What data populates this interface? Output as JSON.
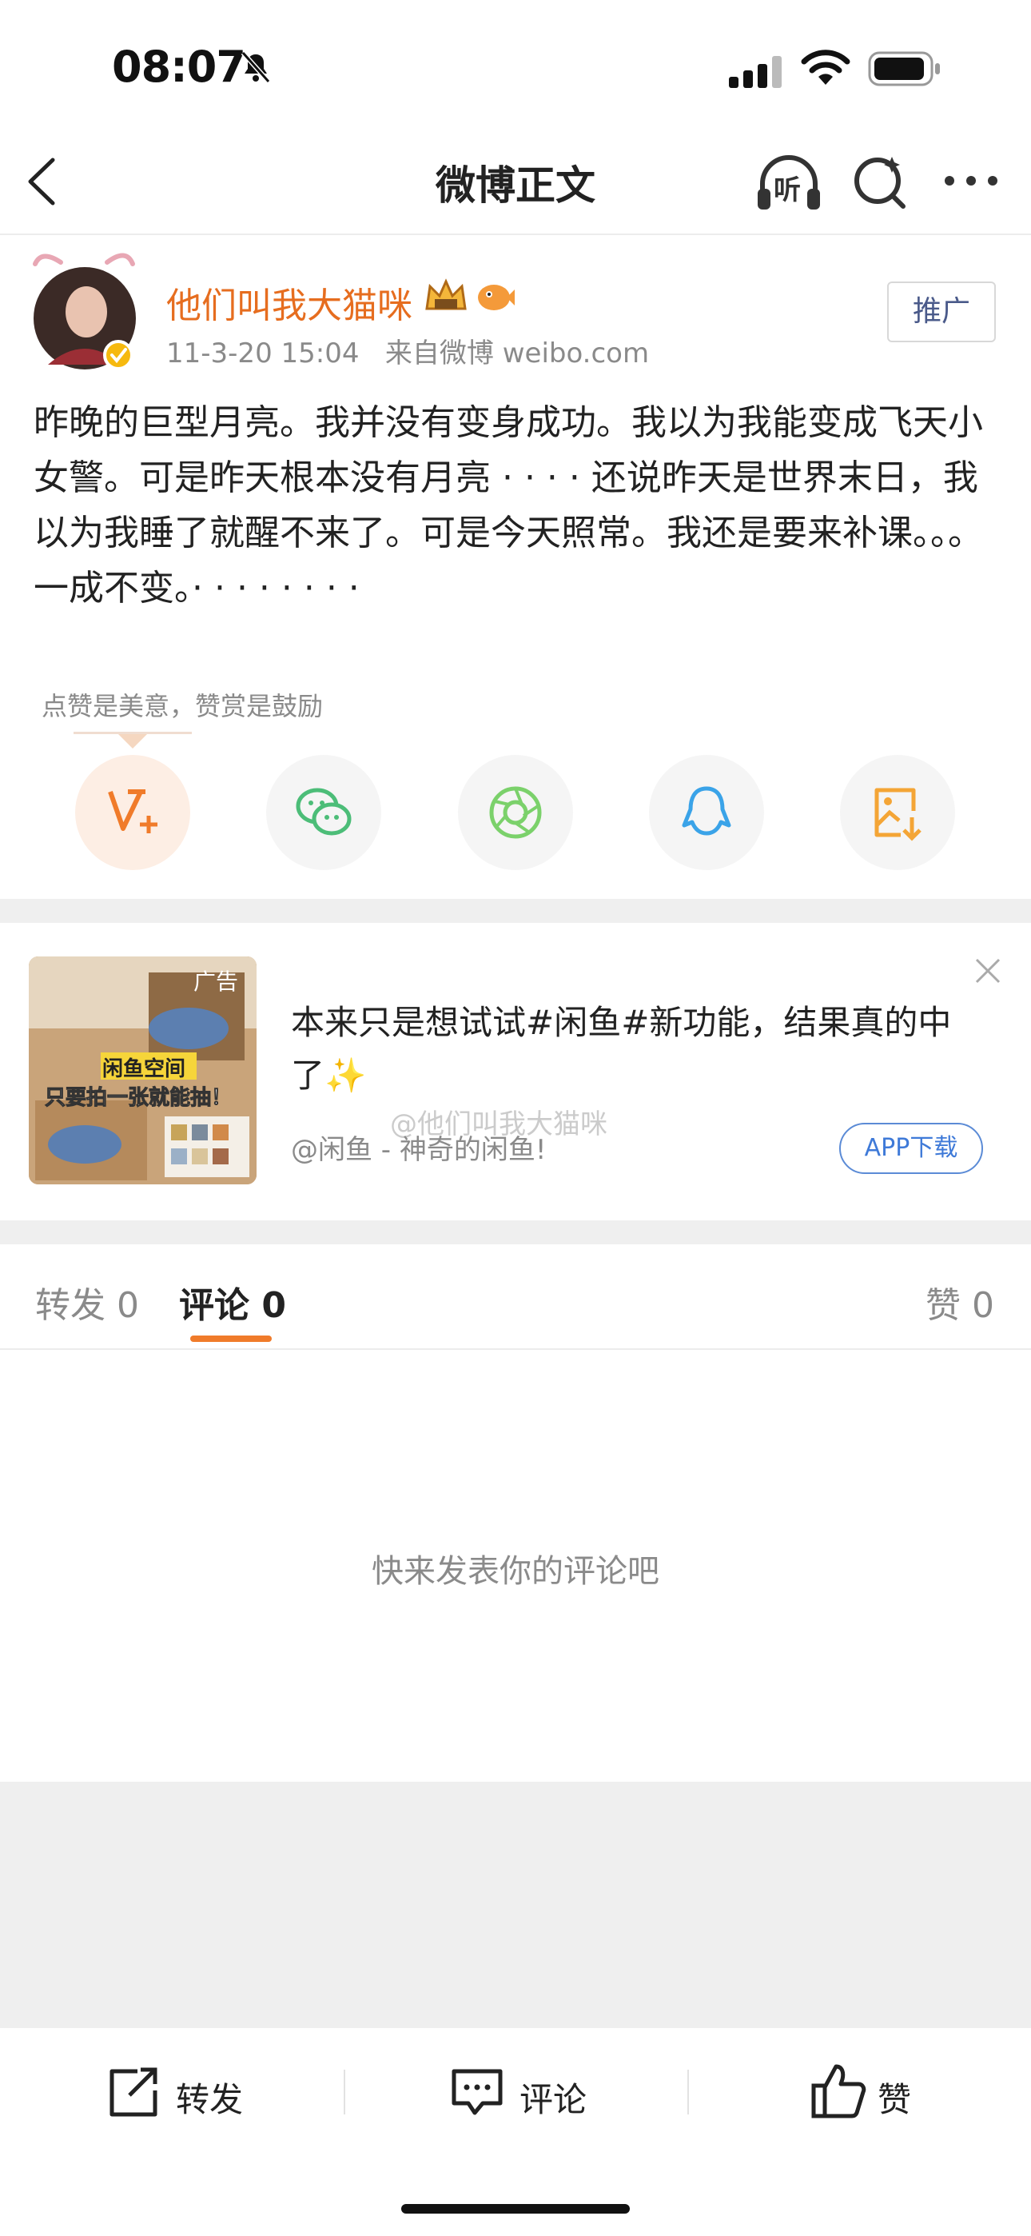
{
  "status_bar": {
    "time": "08:07",
    "icons": [
      "bell-slash-icon",
      "signal-icon",
      "wifi-icon",
      "battery-icon"
    ]
  },
  "nav": {
    "title": "微博正文",
    "back_icon": "chevron-left-icon",
    "listen_label": "听",
    "search_icon": "search-icon",
    "more_icon": "more-icon"
  },
  "post": {
    "username": "他们叫我大猫咪",
    "meta": "11-3-20 15:04   来自微博 weibo.com",
    "promote_label": "推广",
    "text": "昨晚的巨型月亮。我并没有变身成功。我以为我能变成飞天小女警。可是昨天根本没有月亮 · · · · 还说昨天是世界末日，我以为我睡了就醒不来了。可是今天照常。我还是要来补课。。。一成不变。· · · · · · · ·",
    "reward_tip": "点赞是美意，赞赏是鼓励",
    "share_buttons": [
      "reward-icon",
      "wechat-icon",
      "moments-icon",
      "qq-icon",
      "save-image-icon"
    ]
  },
  "ad": {
    "badge": "广告",
    "thumb_caption_1": "闲鱼空间",
    "thumb_caption_2": "只要拍一张就能抽！",
    "text": "本来只是想试试#闲鱼#新功能，结果真的中了✨",
    "source": "@闲鱼 - 神奇的闲鱼!",
    "watermark": "@他们叫我大猫咪",
    "download_label": "APP下载"
  },
  "tabs": {
    "repost": "转发 0",
    "comment": "评论 0",
    "like": "赞 0",
    "active": "comment"
  },
  "comments": {
    "empty_hint": "快来发表你的评论吧"
  },
  "bottom_bar": {
    "repost": "转发",
    "comment": "评论",
    "like": "赞"
  },
  "colors": {
    "accent": "#f07b2a",
    "username": "#e66d1f",
    "link_blue": "#3f7ad8"
  }
}
